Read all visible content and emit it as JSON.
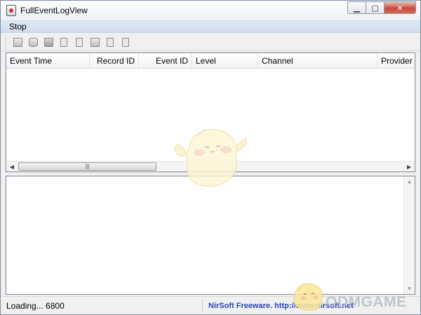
{
  "window": {
    "title": "FullEventLogView",
    "controls": [
      "minimize",
      "maximize",
      "close"
    ]
  },
  "menubar": {
    "items": [
      "Stop"
    ]
  },
  "toolbar": {
    "icons": [
      "properties-icon",
      "database-icon",
      "save-icon",
      "report-icon",
      "copy-icon",
      "open-icon",
      "find-icon",
      "exit-icon"
    ]
  },
  "list": {
    "columns": [
      "Event Time",
      "Record ID",
      "Event ID",
      "Level",
      "Channel",
      "Provider"
    ],
    "rows": []
  },
  "status": {
    "loading": "Loading... 6800",
    "credit": "NirSoft Freeware.  http://www.nirsoft.net"
  },
  "watermark": {
    "text": "ODMGAME"
  }
}
